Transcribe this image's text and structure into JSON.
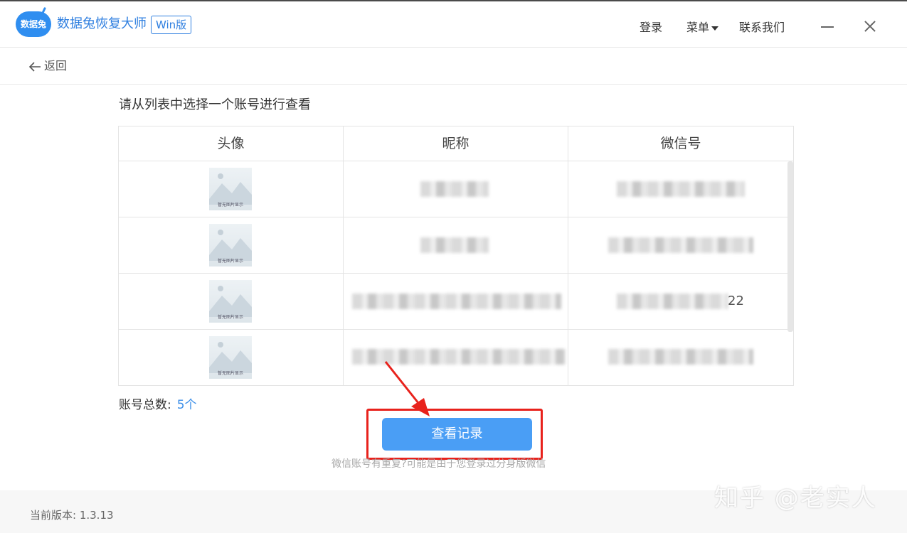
{
  "titlebar": {
    "logo_text": "数据兔",
    "app_name": "数据兔恢复大师",
    "edition_badge": "Win版",
    "nav": {
      "login": "登录",
      "menu": "菜单",
      "contact": "联系我们"
    }
  },
  "backbar": {
    "back_label": "返回"
  },
  "main": {
    "instruction": "请从列表中选择一个账号进行查看",
    "table": {
      "columns": [
        "头像",
        "昵称",
        "微信号"
      ],
      "rows": [
        {
          "avatar_caption": "暂无图片显示",
          "nickname": "",
          "wechat_id": ""
        },
        {
          "avatar_caption": "暂无图片显示",
          "nickname": "",
          "wechat_id": ""
        },
        {
          "avatar_caption": "暂无图片显示",
          "nickname": "",
          "wechat_id_tail": "22"
        },
        {
          "avatar_caption": "暂无图片显示",
          "nickname": "",
          "wechat_id": ""
        }
      ]
    },
    "total_label": "账号总数:",
    "total_count": "5个",
    "view_button": "查看记录",
    "hint": "微信账号有重复?可能是由于您登录过分身版微信"
  },
  "footer": {
    "version": "当前版本: 1.3.13"
  },
  "watermark": "知乎 @老实人",
  "colors": {
    "accent": "#2f7fe0",
    "button": "#4a9ef5",
    "highlight": "#e8221c"
  }
}
